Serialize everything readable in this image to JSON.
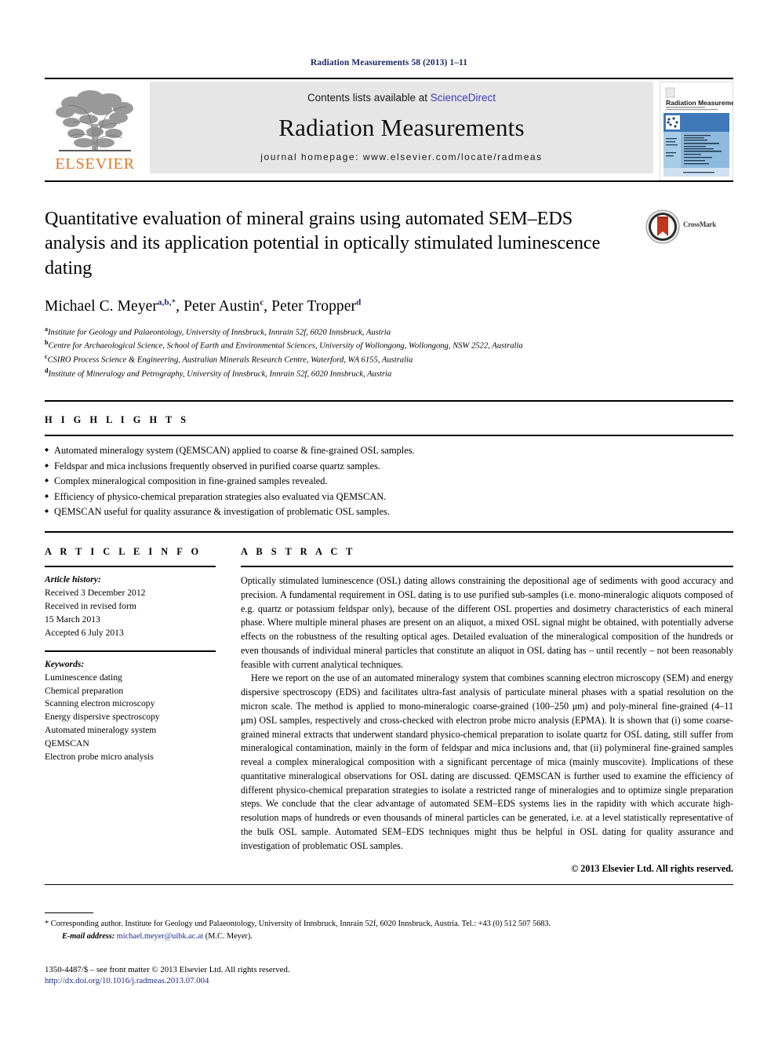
{
  "running_head": "Radiation Measurements 58 (2013) 1–11",
  "masthead": {
    "publisher_name": "ELSEVIER",
    "contents_prefix": "Contents lists available at ",
    "sciencedirect_label": "ScienceDirect",
    "journal_title": "Radiation Measurements",
    "journal_homepage": "journal homepage: www.elsevier.com/locate/radmeas",
    "cover_title": "Radiation Measurements",
    "accent_orange": "#E87722",
    "link_blue": "#3b3bbf",
    "panel_grey": "#e6e6e6"
  },
  "article": {
    "title": "Quantitative evaluation of mineral grains using automated SEM–EDS analysis and its application potential in optically stimulated luminescence dating",
    "crossmark_label": "CrossMark",
    "authors": [
      {
        "name": "Michael C. Meyer",
        "marks": "a,b,",
        "star": "*",
        "sep": ", "
      },
      {
        "name": "Peter Austin",
        "marks": "c",
        "star": "",
        "sep": ", "
      },
      {
        "name": "Peter Tropper",
        "marks": "d",
        "star": "",
        "sep": ""
      }
    ],
    "affiliations": [
      {
        "mark": "a",
        "text": "Institute for Geology und Palaeontology, University of Innsbruck, Innrain 52f, 6020 Innsbruck, Austria"
      },
      {
        "mark": "b",
        "text": "Centre for Archaeological Science, School of Earth and Environmental Sciences, University of Wollongong, Wollongong, NSW 2522, Australia"
      },
      {
        "mark": "c",
        "text": "CSIRO Process Science & Engineering, Australian Minerals Research Centre, Waterford, WA 6155, Australia"
      },
      {
        "mark": "d",
        "text": "Institute of Mineralogy and Petrography, University of Innsbruck, Innrain 52f, 6020 Innsbruck, Austria"
      }
    ]
  },
  "highlights": {
    "label": "H I G H L I G H T S",
    "items": [
      "Automated mineralogy system (QEMSCAN) applied to coarse & fine-grained OSL samples.",
      "Feldspar and mica inclusions frequently observed in purified coarse quartz samples.",
      "Complex mineralogical composition in fine-grained samples revealed.",
      "Efficiency of physico-chemical preparation strategies also evaluated via QEMSCAN.",
      "QEMSCAN useful for quality assurance & investigation of problematic OSL samples."
    ]
  },
  "article_info": {
    "label": "A R T I C L E   I N F O",
    "history_label": "Article history:",
    "history": [
      "Received 3 December 2012",
      "Received in revised form",
      "15 March 2013",
      "Accepted 6 July 2013"
    ],
    "keywords_label": "Keywords:",
    "keywords": [
      "Luminescence dating",
      "Chemical preparation",
      "Scanning electron microscopy",
      "Energy dispersive spectroscopy",
      "Automated mineralogy system",
      "QEMSCAN",
      "Electron probe micro analysis"
    ]
  },
  "abstract": {
    "label": "A B S T R A C T",
    "paragraph_1": "Optically stimulated luminescence (OSL) dating allows constraining the depositional age of sediments with good accuracy and precision. A fundamental requirement in OSL dating is to use purified sub-samples (i.e. mono-mineralogic aliquots composed of e.g. quartz or potassium feldspar only), because of the different OSL properties and dosimetry characteristics of each mineral phase. Where multiple mineral phases are present on an aliquot, a mixed OSL signal might be obtained, with potentially adverse effects on the robustness of the resulting optical ages. Detailed evaluation of the mineralogical composition of the hundreds or even thousands of individual mineral particles that constitute an aliquot in OSL dating has – until recently – not been reasonably feasible with current analytical techniques.",
    "paragraph_2": "Here we report on the use of an automated mineralogy system that combines scanning electron microscopy (SEM) and energy dispersive spectroscopy (EDS) and facilitates ultra-fast analysis of particulate mineral phases with a spatial resolution on the micron scale. The method is applied to mono-mineralogic coarse-grained (100–250 μm) and poly-mineral fine-grained (4–11 μm) OSL samples, respectively and cross-checked with electron probe micro analysis (EPMA). It is shown that (i) some coarse-grained mineral extracts that underwent standard physico-chemical preparation to isolate quartz for OSL dating, still suffer from mineralogical contamination, mainly in the form of feldspar and mica inclusions and, that (ii) polymineral fine-grained samples reveal a complex mineralogical composition with a significant percentage of mica (mainly muscovite). Implications of these quantitative mineralogical observations for OSL dating are discussed. QEMSCAN is further used to examine the efficiency of different physico-chemical preparation strategies to isolate a restricted range of mineralogies and to optimize single preparation steps. We conclude that the clear advantage of automated SEM–EDS systems lies in the rapidity with which accurate high-resolution maps of hundreds or even thousands of mineral particles can be generated, i.e. at a level statistically representative of the bulk OSL sample. Automated SEM–EDS techniques might thus be helpful in OSL dating for quality assurance and investigation of problematic OSL samples.",
    "copyright": "© 2013 Elsevier Ltd. All rights reserved."
  },
  "footer": {
    "corresponding_star": "*",
    "corresponding_text": "Corresponding author. Institute for Geology und Palaeontology, University of Innsbruck, Innrain 52f, 6020 Innsbruck, Austria. Tel.: +43 (0) 512 507 5683.",
    "email_label": "E-mail address:",
    "email": "michael.meyer@uibk.ac.at",
    "email_attribution": "(M.C. Meyer).",
    "issn_line": "1350-4487/$ – see front matter © 2013 Elsevier Ltd. All rights reserved.",
    "doi_line": "http://dx.doi.org/10.1016/j.radmeas.2013.07.004"
  }
}
